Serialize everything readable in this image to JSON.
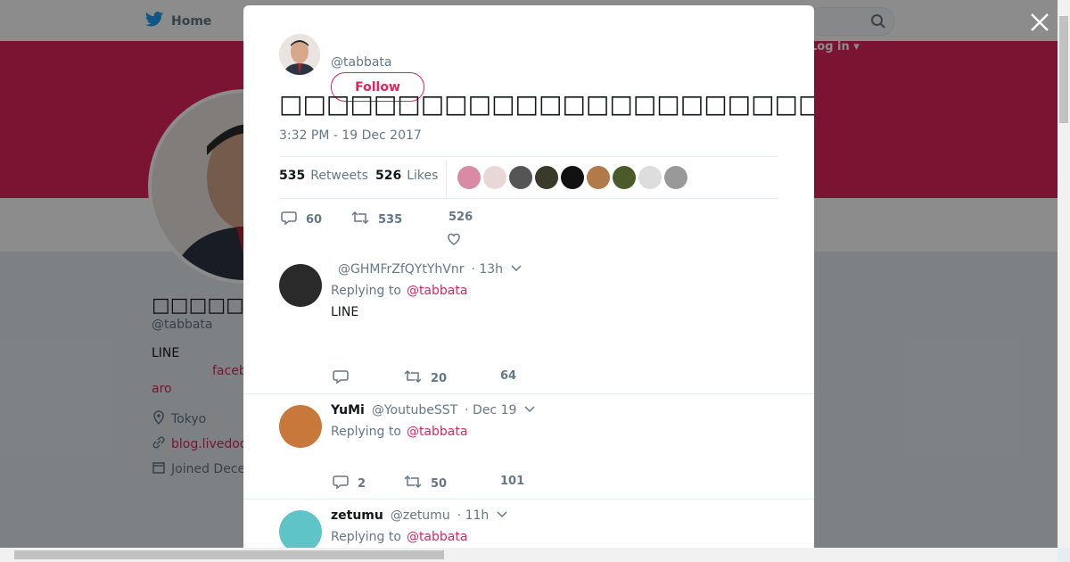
{
  "nav": {
    "home_label": "Home",
    "login_label": "Log in ▾"
  },
  "profile": {
    "display_name": "□□□□□□",
    "handle": "@tabbata",
    "bio": "LINE",
    "bio_link_1": "faceb",
    "bio_link_2": "aro",
    "location": "Tokyo",
    "url": "blog.livedoo",
    "joined": "Joined Dece"
  },
  "tweet": {
    "author_handle": "@tabbata",
    "follow_label": "Follow",
    "text": "□□□□□□□□□□□□□□□□□□□□□□□□□□□□□□□□□□□□□□□□□□□□□",
    "timestamp": "3:32 PM - 19 Dec 2017",
    "retweets_count": "535",
    "retweets_label": "Retweets",
    "likes_count": "526",
    "likes_label": "Likes",
    "reply_count": "60",
    "retweet_count": "535",
    "like_count": "526"
  },
  "replies": [
    {
      "name": "",
      "handle": "@GHMFrZfQYtYhVnr",
      "time": "· 13h",
      "replying_prefix": "Replying to",
      "replying_to": "@tabbata",
      "text": "LINE",
      "reply_count": "",
      "retweet_count": "20",
      "like_count": "64"
    },
    {
      "name": "YuMi",
      "handle": "@YoutubeSST",
      "time": "· Dec 19",
      "replying_prefix": "Replying to",
      "replying_to": "@tabbata",
      "text": "",
      "reply_count": "2",
      "retweet_count": "50",
      "like_count": "101"
    },
    {
      "name": "zetumu",
      "handle": "@zetumu",
      "time": "· 11h",
      "replying_prefix": "Replying to",
      "replying_to": "@tabbata",
      "text": ""
    }
  ],
  "colors": {
    "accent": "#e0245e",
    "muted": "#657786",
    "border": "#e6ecf0"
  }
}
